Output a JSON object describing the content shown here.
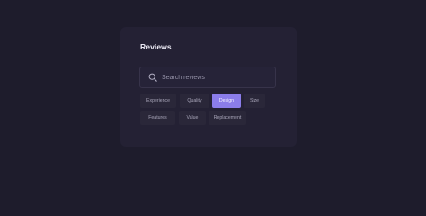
{
  "panel": {
    "title": "Reviews"
  },
  "search": {
    "placeholder": "Search reviews",
    "value": ""
  },
  "tags": [
    {
      "label": "Experience",
      "selected": false
    },
    {
      "label": "Quality",
      "selected": false
    },
    {
      "label": "Design",
      "selected": true
    },
    {
      "label": "Size",
      "selected": false
    },
    {
      "label": "Features",
      "selected": false
    },
    {
      "label": "Value",
      "selected": false
    },
    {
      "label": "Replacement",
      "selected": false
    }
  ],
  "colors": {
    "background": "#1e1c2c",
    "panel": "#242134",
    "accent": "#8b7dea",
    "chip": "#2a2739"
  },
  "icons": {
    "search": "search-icon"
  }
}
